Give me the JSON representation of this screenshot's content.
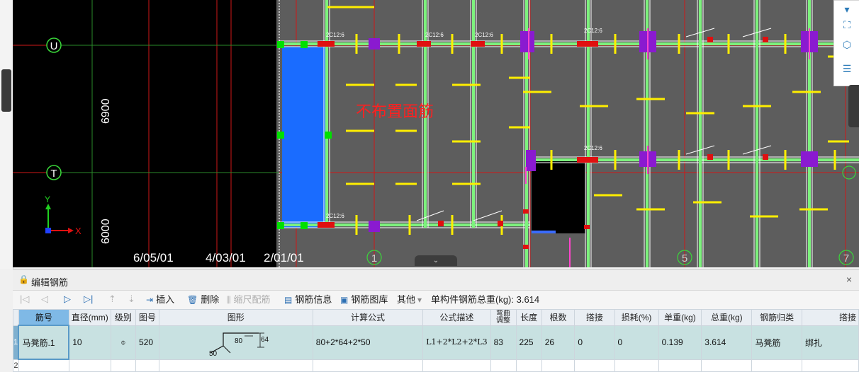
{
  "cad": {
    "axis_labels": {
      "U": "U",
      "T": "T",
      "c1": "1",
      "c5": "5",
      "c7": "7"
    },
    "bottom_axis_text": [
      "6/05/01",
      "4/03/01",
      "2/01/01"
    ],
    "dimensions": [
      "6900",
      "6000"
    ],
    "slab_annotation": "不布置面筋",
    "rebar_tags": [
      "2C12:6",
      "2C12:6",
      "2C12:6",
      "2C12:6",
      "2C12:6",
      "2C12:6",
      "2C12:6"
    ],
    "coord_axes": {
      "x": "X",
      "y": "Y"
    },
    "colors": {
      "background": "#000000",
      "slab": "#5d5d5d",
      "wall": "#1a6cff",
      "beam": "#7df27d",
      "note": "#ff2020"
    }
  },
  "panel": {
    "title": "编辑钢筋",
    "close": "×",
    "toolbar": {
      "insert": "插入",
      "delete": "删除",
      "scale": "缩尺配筋",
      "info": "钢筋信息",
      "library": "钢筋图库",
      "other": "其他",
      "total_label": "单构件钢筋总重(kg): 3.614"
    },
    "columns": [
      "筋号",
      "直径(mm)",
      "级别",
      "图号",
      "图形",
      "计算公式",
      "公式描述",
      "弯曲调整",
      "长度",
      "根数",
      "搭接",
      "损耗(%)",
      "单重(kg)",
      "总重(kg)",
      "钢筋归类",
      "搭接"
    ],
    "rows": [
      {
        "index": "1",
        "name": "马凳筋.1",
        "diameter": "10",
        "grade": "⌽",
        "fig": "520",
        "shape_dims": {
          "a": "80",
          "b": "64",
          "c": "50"
        },
        "formula": "80+2*64+2*50",
        "desc": "L1+2*L2+2*L3",
        "bend": "83",
        "length": "225",
        "count": "26",
        "lap": "0",
        "loss": "0",
        "unit_weight": "0.139",
        "total_weight": "3.614",
        "category": "马凳筋",
        "lap_type": "绑扎"
      }
    ],
    "row2_index": "2"
  }
}
